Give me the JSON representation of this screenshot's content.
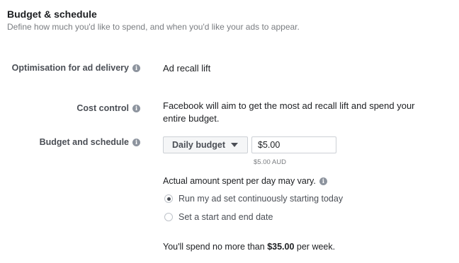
{
  "section": {
    "title": "Budget & schedule",
    "subtitle": "Define how much you'd like to spend, and when you'd like your ads to appear."
  },
  "optimisation": {
    "label": "Optimisation for ad delivery",
    "value": "Ad recall lift"
  },
  "cost_control": {
    "label": "Cost control",
    "value": "Facebook will aim to get the most ad recall lift and spend your entire budget."
  },
  "budget_schedule": {
    "label": "Budget and schedule",
    "budget_type": "Daily budget",
    "amount": "$5.00",
    "currency_note": "$5.00 AUD",
    "vary_note": "Actual amount spent per day may vary.",
    "options": [
      {
        "label": "Run my ad set continuously starting today",
        "selected": true
      },
      {
        "label": "Set a start and end date",
        "selected": false
      }
    ],
    "spend_prefix": "You'll spend no more than",
    "spend_amount": "$35.00",
    "spend_suffix": "per week."
  },
  "icons": {
    "info": "info-icon"
  },
  "colors": {
    "label": "#4b4f56",
    "muted": "#7a7d81",
    "icon": "#8d949e"
  }
}
